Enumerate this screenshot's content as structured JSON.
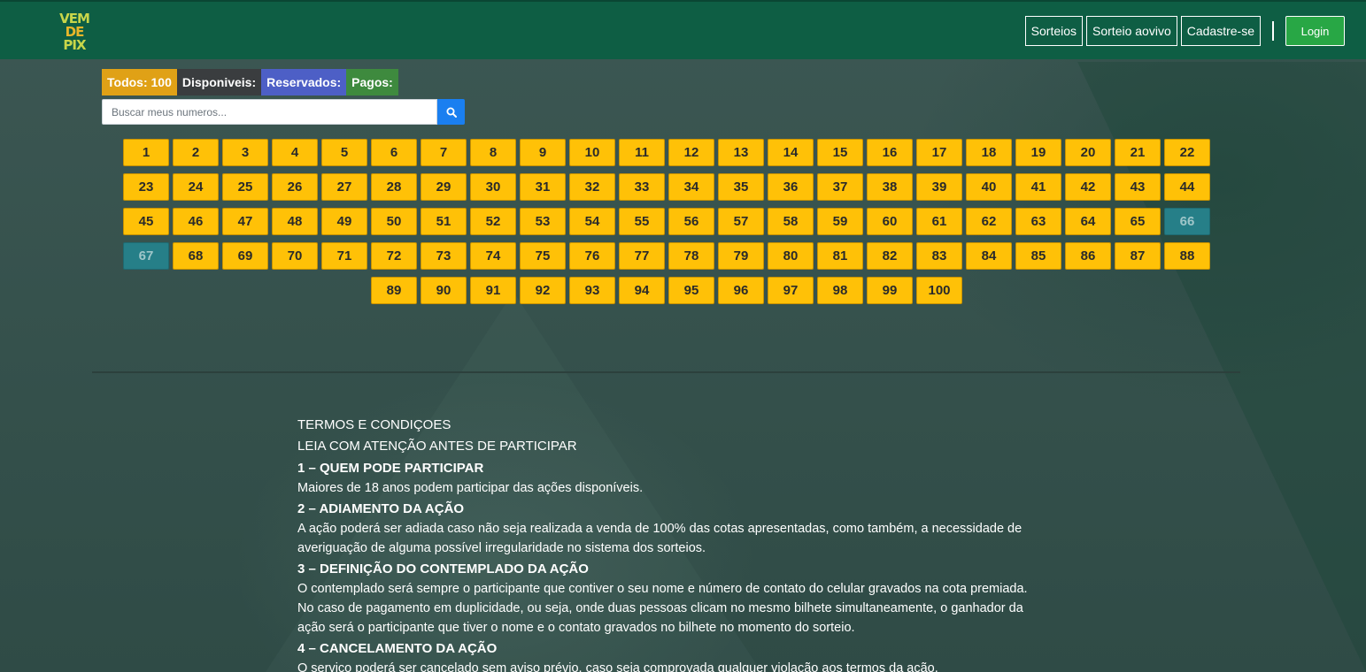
{
  "header": {
    "logo": [
      "VEM",
      "DE",
      "PIX"
    ],
    "nav": [
      "Sorteios",
      "Sorteio aovivo",
      "Cadastre-se"
    ],
    "login_label": "Login"
  },
  "filters": {
    "all": "Todos: 100",
    "available": "Disponiveis:",
    "reserved": "Reservados:",
    "paid": "Pagos:"
  },
  "search": {
    "placeholder": "Buscar meus numeros..."
  },
  "numbers": {
    "total": 100,
    "reserved": [
      66,
      67
    ]
  },
  "terms": {
    "title": "TERMOS E CONDIÇOES",
    "subtitle": "LEIA COM ATENÇÃO ANTES DE PARTICIPAR",
    "s1_title": "1 – QUEM PODE PARTICIPAR",
    "s1_text": "Maiores de 18 anos podem participar das ações disponíveis.",
    "s2_title": "2 – ADIAMENTO DA AÇÃO",
    "s2_text": "A ação poderá ser adiada caso não seja realizada a venda de 100% das cotas apresentadas, como também, a necessidade de averiguação de alguma possível irregularidade no sistema dos sorteios.",
    "s3_title": "3 – DEFINIÇÃO DO CONTEMPLADO DA AÇÃO",
    "s3_text": "O contemplado será sempre o participante que contiver o seu nome e número de contato do celular gravados na cota premiada. No caso de pagamento em duplicidade, ou seja, onde duas pessoas clicam no mesmo bilhete simultaneamente, o ganhador da ação será o participante que tiver o nome e o contato gravados no bilhete no momento do sorteio.",
    "s4_title": "4 – CANCELAMENTO DA AÇÃO",
    "s4_text": "O serviço poderá ser cancelado sem aviso prévio, caso seja comprovada qualquer violação aos termos da ação."
  }
}
